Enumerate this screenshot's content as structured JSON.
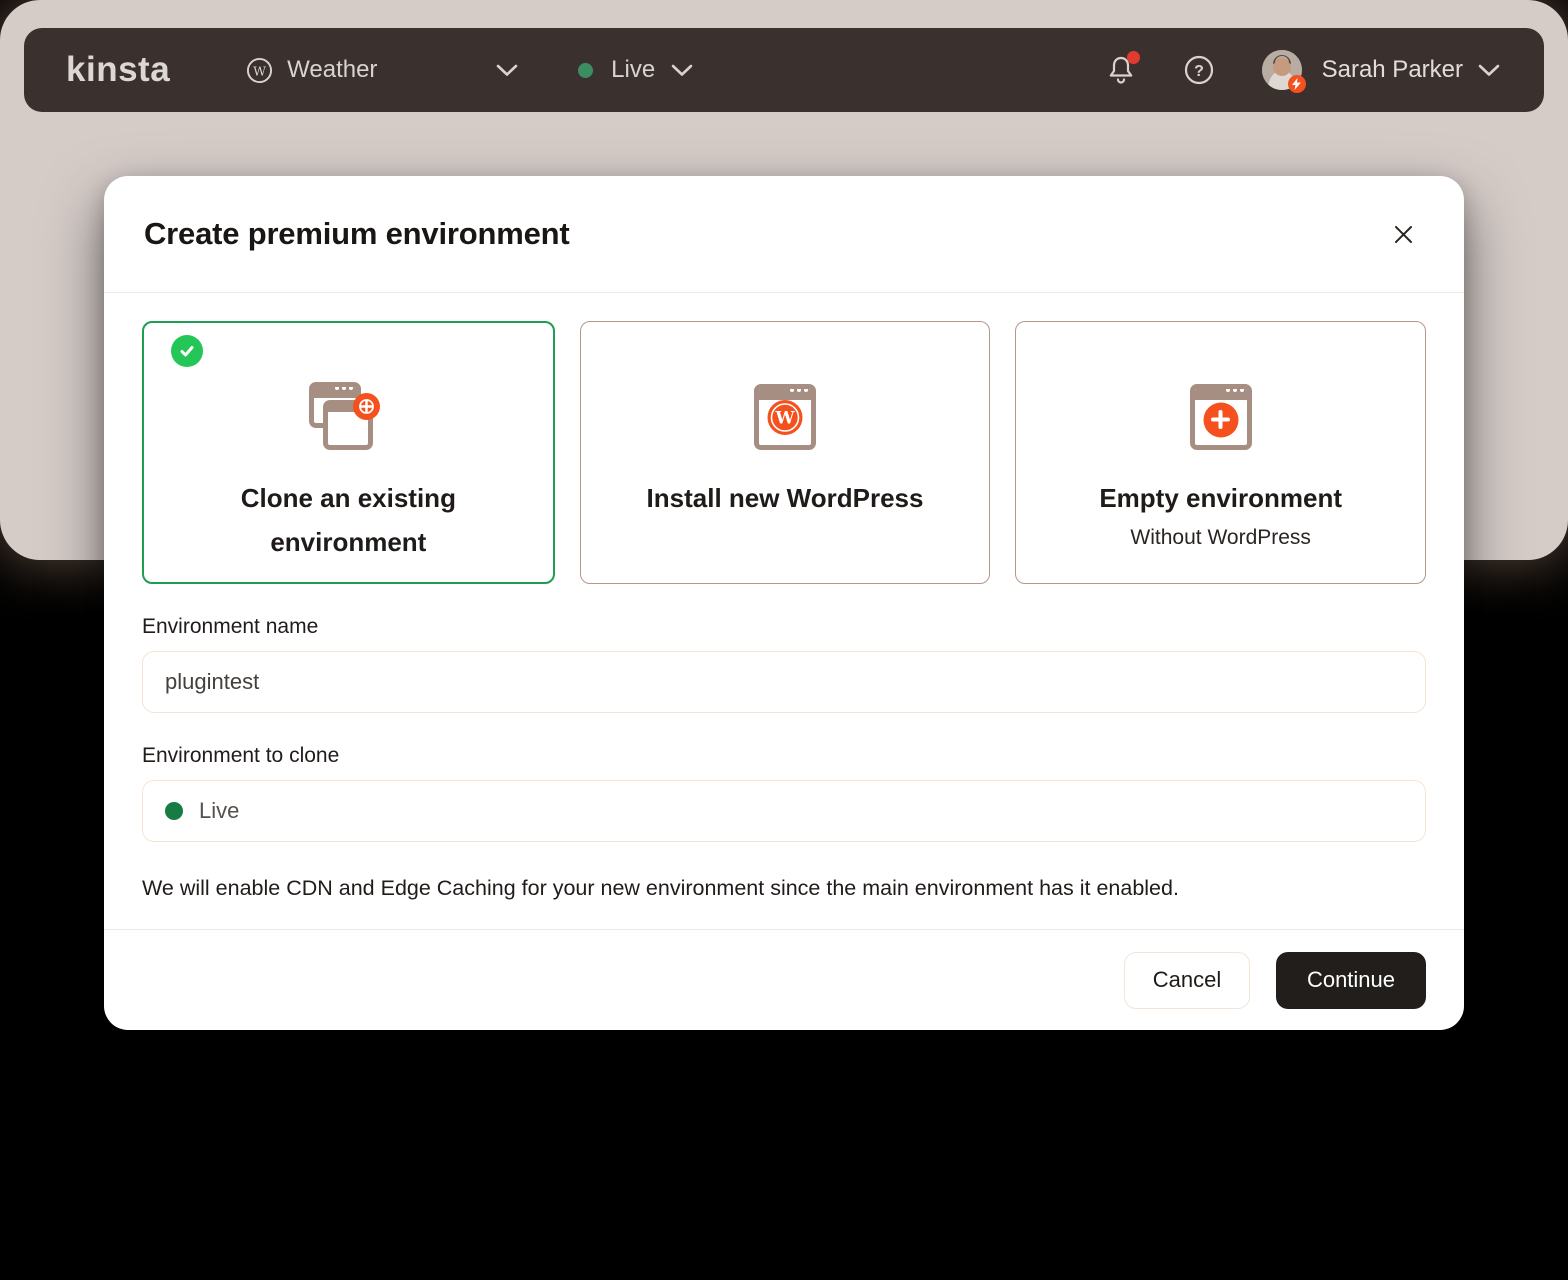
{
  "navbar": {
    "logo": "kinsta",
    "site": {
      "name": "Weather"
    },
    "environment": {
      "name": "Live",
      "status_color": "#3c8e62"
    },
    "notifications": {
      "has_unread": true,
      "badge_color": "#e23a30"
    },
    "user": {
      "name": "Sarah Parker"
    }
  },
  "modal": {
    "title": "Create premium environment",
    "options": [
      {
        "title": "Clone an existing environment",
        "selected": true
      },
      {
        "title": "Install new WordPress",
        "selected": false
      },
      {
        "title": "Empty environment",
        "subtitle": "Without WordPress",
        "selected": false
      }
    ],
    "form": {
      "name_label": "Environment name",
      "name_value": "plugintest",
      "clone_label": "Environment to clone",
      "clone_value": "Live",
      "clone_status_color": "#177c43"
    },
    "info": "We will enable CDN and Edge Caching for your new environment since the main environment has it enabled.",
    "footer": {
      "cancel": "Cancel",
      "continue": "Continue"
    }
  },
  "colors": {
    "background_top": "#d5ccc8",
    "background_bottom": "#000000",
    "navbar_bg": "#3a312e",
    "accent_orange": "#f4511e",
    "selected_green": "#1e9e50",
    "check_green": "#24c757",
    "card_border": "#b5988c",
    "input_border": "#f4e4d8",
    "continue_bg": "#221e1c"
  }
}
